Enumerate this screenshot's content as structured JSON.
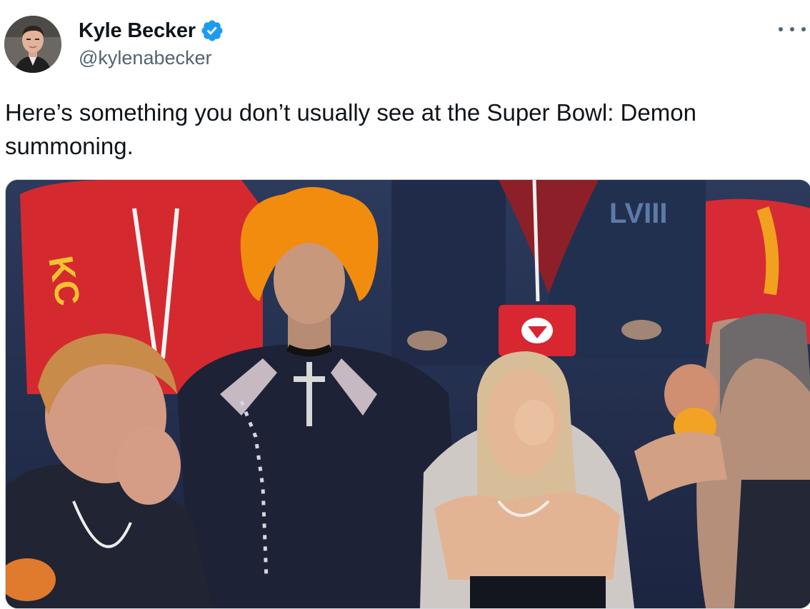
{
  "tweet": {
    "author": {
      "display_name": "Kyle Becker",
      "handle": "@kylenabecker",
      "verified": true,
      "avatar_icon": "user-avatar"
    },
    "more_icon": "more-horizontal-icon",
    "text": "Here’s something you don’t usually see at the Super Bowl: Demon summoning.",
    "media": {
      "type": "video-still",
      "overlay_text": [
        "KC",
        "LVIII"
      ],
      "icon": "chiefs-arrowhead-badge"
    }
  },
  "colors": {
    "text_primary": "#0f1419",
    "text_secondary": "#536471",
    "verified_blue": "#1d9bf0",
    "chiefs_red": "#e31837",
    "hair_orange": "#f28c0f"
  }
}
